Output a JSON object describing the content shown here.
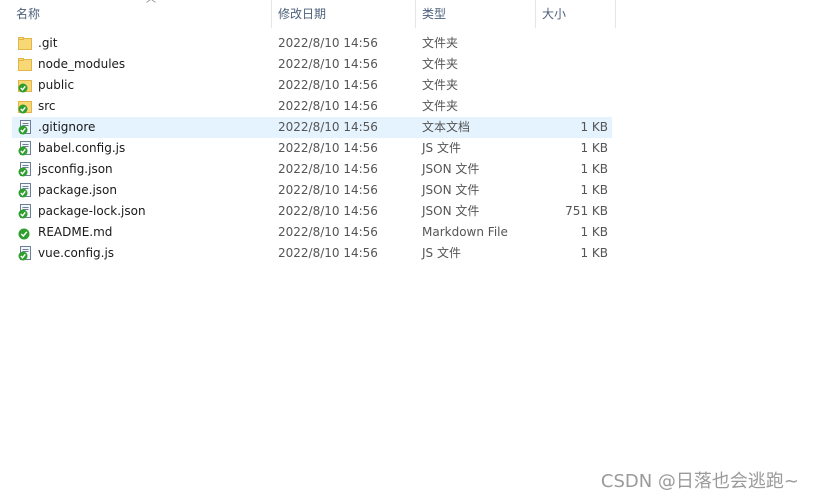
{
  "columns": {
    "name": "名称",
    "modified": "修改日期",
    "type": "类型",
    "size": "大小"
  },
  "files": [
    {
      "name": ".git",
      "modified": "2022/8/10 14:56",
      "type": "文件夹",
      "size": "",
      "icon": "folder-icon",
      "selected": false
    },
    {
      "name": "node_modules",
      "modified": "2022/8/10 14:56",
      "type": "文件夹",
      "size": "",
      "icon": "folder-icon",
      "selected": false
    },
    {
      "name": "public",
      "modified": "2022/8/10 14:56",
      "type": "文件夹",
      "size": "",
      "icon": "folder-check-icon",
      "selected": false
    },
    {
      "name": "src",
      "modified": "2022/8/10 14:56",
      "type": "文件夹",
      "size": "",
      "icon": "folder-check-icon",
      "selected": false
    },
    {
      "name": ".gitignore",
      "modified": "2022/8/10 14:56",
      "type": "文本文档",
      "size": "1 KB",
      "icon": "document-check-icon",
      "selected": true
    },
    {
      "name": "babel.config.js",
      "modified": "2022/8/10 14:56",
      "type": "JS 文件",
      "size": "1 KB",
      "icon": "document-check-icon",
      "selected": false
    },
    {
      "name": "jsconfig.json",
      "modified": "2022/8/10 14:56",
      "type": "JSON 文件",
      "size": "1 KB",
      "icon": "document-check-icon",
      "selected": false
    },
    {
      "name": "package.json",
      "modified": "2022/8/10 14:56",
      "type": "JSON 文件",
      "size": "1 KB",
      "icon": "document-check-icon",
      "selected": false
    },
    {
      "name": "package-lock.json",
      "modified": "2022/8/10 14:56",
      "type": "JSON 文件",
      "size": "751 KB",
      "icon": "document-check-icon",
      "selected": false
    },
    {
      "name": "README.md",
      "modified": "2022/8/10 14:56",
      "type": "Markdown File",
      "size": "1 KB",
      "icon": "check-badge-icon",
      "selected": false
    },
    {
      "name": "vue.config.js",
      "modified": "2022/8/10 14:56",
      "type": "JS 文件",
      "size": "1 KB",
      "icon": "document-check-icon",
      "selected": false
    }
  ],
  "watermark": "CSDN @日落也会逃跑~",
  "colors": {
    "folder": "#f8d775",
    "check": "#2e9e2e",
    "selected_row": "#e5f3ff",
    "header_text": "#4c607a"
  }
}
